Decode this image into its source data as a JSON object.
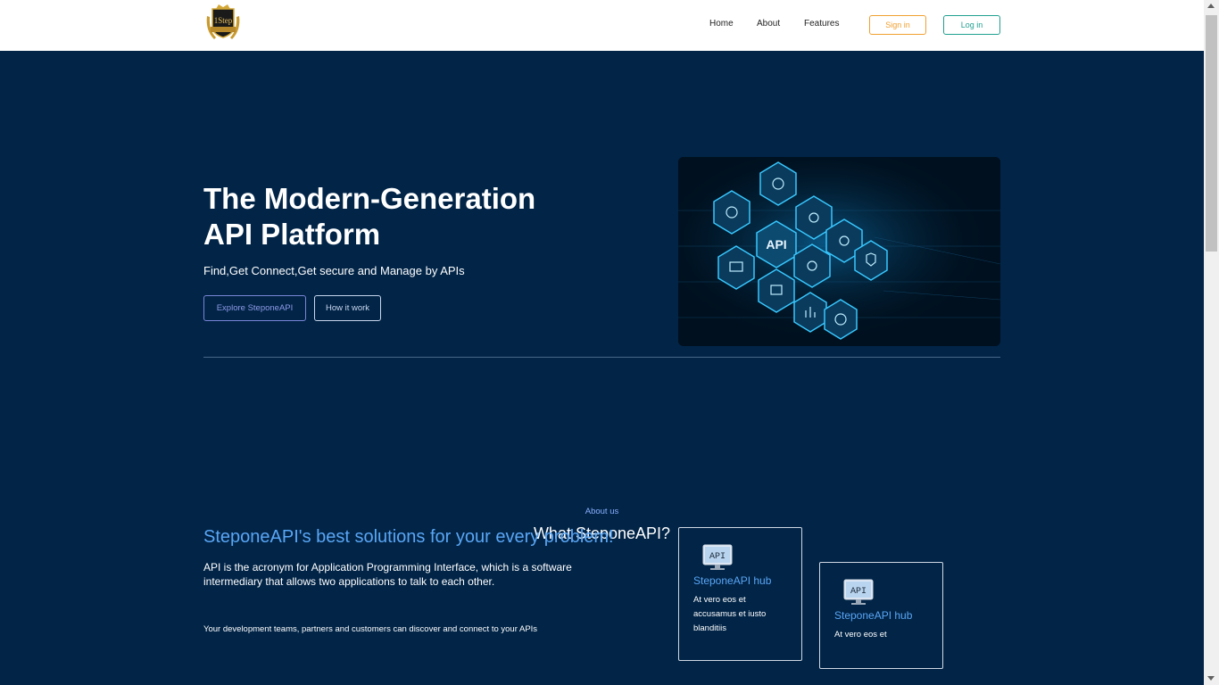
{
  "header": {
    "logo_text": "1Step",
    "nav": [
      "Home",
      "About",
      "Features"
    ],
    "signin_label": "Sign in",
    "login_label": "Log in"
  },
  "hero": {
    "title_line1": "The Modern-Generation",
    "title_line2": "API Platform",
    "subtitle": "Find,Get Connect,Get secure and Manage by APIs",
    "explore_label": "Explore SteponeAPI",
    "how_label": "How it work",
    "image_center_label": "API"
  },
  "about": {
    "kicker": "About us",
    "title": "What SteponeAPI?",
    "heading": "SteponeAPI's best solutions for your every problem!",
    "para1": "API is the acronym for Application Programming Interface, which is a software intermediary that allows two applications to talk to each other.",
    "para2": "Your development teams, partners and customers can discover and connect to your APIs"
  },
  "cards": [
    {
      "icon_text": "API",
      "title": "SteponeAPI hub",
      "text": "At vero eos et accusamus et iusto blanditiis"
    },
    {
      "icon_text": "API",
      "title": "SteponeAPI hub",
      "text": "At vero eos et"
    }
  ],
  "colors": {
    "background": "#012447",
    "accent_blue": "#5aa6f5",
    "signin": "#f0a030",
    "login": "#20a090"
  }
}
